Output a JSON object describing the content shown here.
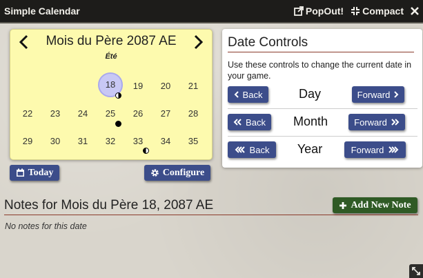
{
  "window": {
    "title": "Simple Calendar",
    "popout_label": "PopOut!",
    "compact_label": "Compact"
  },
  "calendar": {
    "month_title": "Mois du Père 2087 AE",
    "season": "Été",
    "weeks": [
      [
        "",
        "",
        "",
        "18",
        "19",
        "20",
        "21"
      ],
      [
        "22",
        "23",
        "24",
        "25",
        "26",
        "27",
        "28"
      ],
      [
        "29",
        "30",
        "31",
        "32",
        "33",
        "34",
        "35"
      ]
    ],
    "selected_day": "18",
    "today_label": "Today",
    "configure_label": "Configure"
  },
  "date_controls": {
    "title": "Date Controls",
    "description": "Use these controls to change the current date in your game.",
    "rows": [
      {
        "label": "Day",
        "back": "Back",
        "forward": "Forward"
      },
      {
        "label": "Month",
        "back": "Back",
        "forward": "Forward"
      },
      {
        "label": "Year",
        "back": "Back",
        "forward": "Forward"
      }
    ]
  },
  "notes": {
    "title": "Notes for Mois du Père 18, 2087 AE",
    "add_label": "Add New Note",
    "empty_text": "No notes for this date"
  },
  "colors": {
    "calendar_bg": "#fdfaae",
    "button_blue": "#3c4d8a",
    "button_green": "#2f5a25",
    "selected_day": "#c8c8f5",
    "titlebar": "#1d1c1a"
  }
}
